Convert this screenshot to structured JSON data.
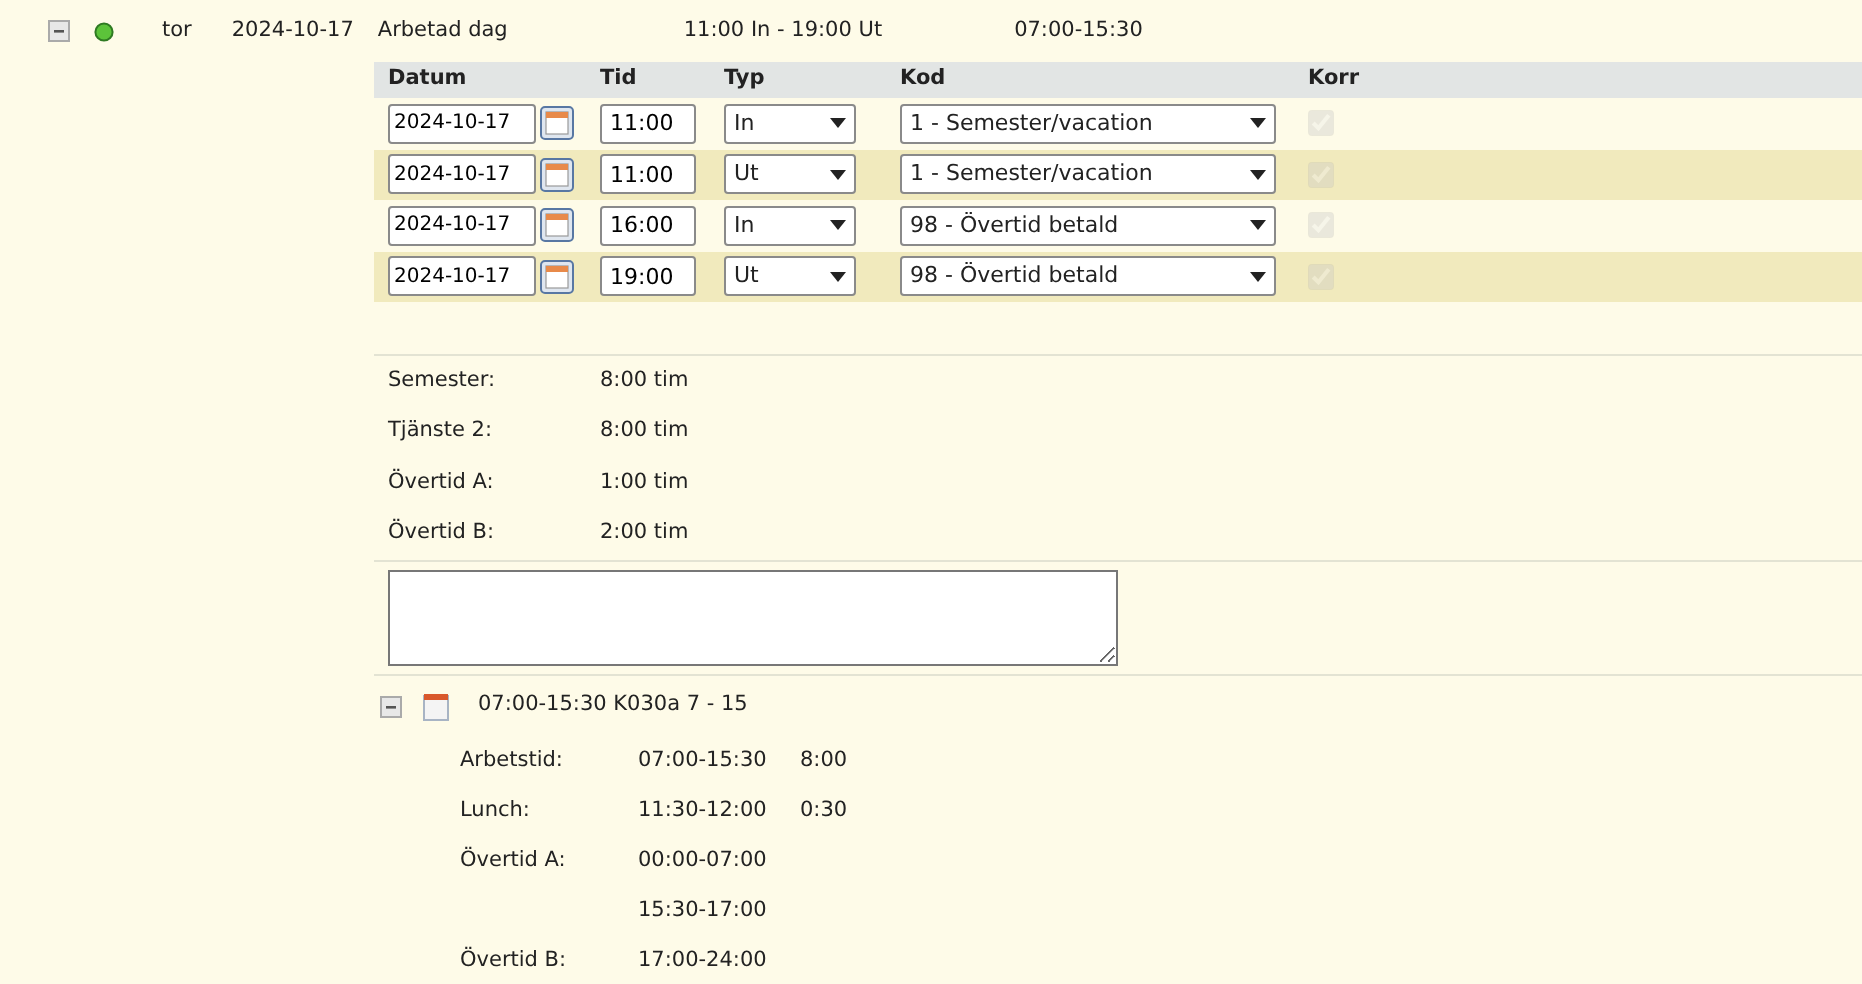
{
  "day": {
    "expanded": true,
    "weekday": "tor",
    "date": "2024-10-17",
    "type": "Arbetad dag",
    "stamps": "11:00 In - 19:00 Ut",
    "schedule": "07:00-15:30"
  },
  "table": {
    "columns": [
      "Datum",
      "Tid",
      "Typ",
      "Kod",
      "Korr"
    ],
    "rows": [
      {
        "date": "2024-10-17",
        "time": "11:00",
        "type": "In",
        "code": "1 - Semester/vacation",
        "korr": true,
        "disabled": true
      },
      {
        "date": "2024-10-17",
        "time": "11:00",
        "type": "Ut",
        "code": "1 - Semester/vacation",
        "korr": true,
        "disabled": true
      },
      {
        "date": "2024-10-17",
        "time": "16:00",
        "type": "In",
        "code": "98 - Övertid betald",
        "korr": true,
        "disabled": true
      },
      {
        "date": "2024-10-17",
        "time": "19:00",
        "type": "Ut",
        "code": "98 - Övertid betald",
        "korr": true,
        "disabled": true
      }
    ]
  },
  "summary": [
    {
      "label": "Semester:",
      "value": "8:00 tim"
    },
    {
      "label": "Tjänste 2:",
      "value": "8:00 tim"
    },
    {
      "label": "Övertid A:",
      "value": "1:00 tim"
    },
    {
      "label": "Övertid B:",
      "value": "2:00 tim"
    }
  ],
  "schedule": {
    "expanded": true,
    "title": "07:00-15:30 K030a 7 - 15",
    "rows": [
      {
        "label": "Arbetstid:",
        "time": "07:00-15:30",
        "hours": "8:00"
      },
      {
        "label": "Lunch:",
        "time": "11:30-12:00",
        "hours": "0:30"
      },
      {
        "label": "Övertid A:",
        "time": "00:00-07:00"
      },
      {
        "time": "15:30-17:00"
      },
      {
        "label": "Övertid B:",
        "time": "17:00-24:00"
      }
    ]
  }
}
